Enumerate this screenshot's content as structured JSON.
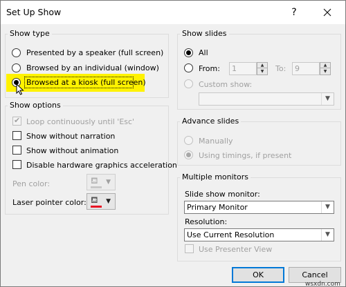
{
  "dialog": {
    "title": "Set Up Show",
    "help": "?",
    "close": "✕"
  },
  "show_type": {
    "legend": "Show type",
    "options": [
      {
        "label": "Presented by a speaker (full screen)",
        "checked": false
      },
      {
        "label": "Browsed by an individual (window)",
        "checked": false
      },
      {
        "label": "Browsed at a kiosk (full screen)",
        "checked": true
      }
    ]
  },
  "show_options": {
    "legend": "Show options",
    "loop": "Loop continuously until 'Esc'",
    "without_narration": "Show without narration",
    "without_animation": "Show without animation",
    "disable_hw": "Disable hardware graphics acceleration",
    "pen_color": "Pen color:",
    "laser_color": "Laser pointer color:",
    "laser_color_value": "#e81123"
  },
  "show_slides": {
    "legend": "Show slides",
    "all": "All",
    "from": "From:",
    "from_value": "1",
    "to": "To:",
    "to_value": "9",
    "custom_show": "Custom show:"
  },
  "advance_slides": {
    "legend": "Advance slides",
    "manually": "Manually",
    "using_timings": "Using timings, if present"
  },
  "monitors": {
    "legend": "Multiple monitors",
    "monitor_label": "Slide show monitor:",
    "monitor_value": "Primary Monitor",
    "resolution_label": "Resolution:",
    "resolution_value": "Use Current Resolution",
    "presenter_view": "Use Presenter View"
  },
  "buttons": {
    "ok": "OK",
    "cancel": "Cancel"
  },
  "watermark": "wsxdn.com"
}
